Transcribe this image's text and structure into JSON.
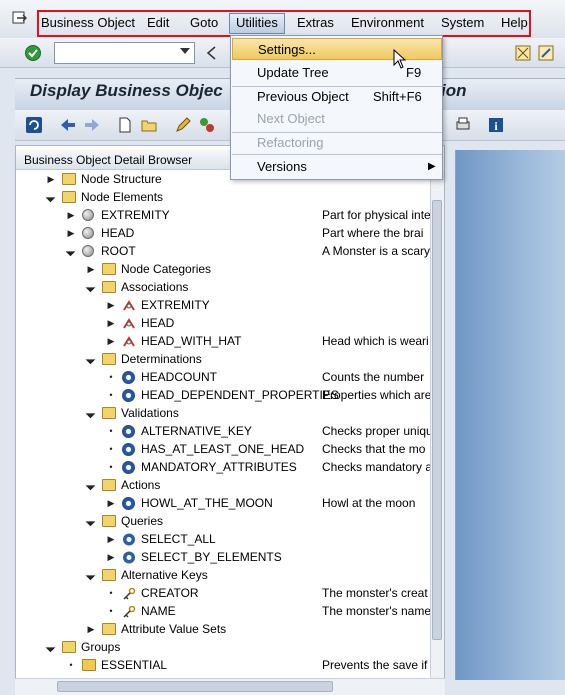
{
  "menubar": {
    "items": [
      "Business Object",
      "Edit",
      "Goto",
      "Utilities",
      "Extras",
      "Environment",
      "System",
      "Help"
    ]
  },
  "title": {
    "left": "Display Business Objec",
    "right": "ion"
  },
  "panel": {
    "header": "Business Object Detail Browser"
  },
  "tree": [
    {
      "label": "Node Structure",
      "desc": ""
    },
    {
      "label": "Node Elements",
      "desc": ""
    },
    {
      "label": "EXTREMITY",
      "desc": "Part for physical inte"
    },
    {
      "label": "HEAD",
      "desc": "Part where the brai"
    },
    {
      "label": "ROOT",
      "desc": "A Monster is a scary"
    },
    {
      "label": "Node Categories",
      "desc": ""
    },
    {
      "label": "Associations",
      "desc": ""
    },
    {
      "label": "EXTREMITY",
      "desc": ""
    },
    {
      "label": "HEAD",
      "desc": ""
    },
    {
      "label": "HEAD_WITH_HAT",
      "desc": "Head which is weari"
    },
    {
      "label": "Determinations",
      "desc": ""
    },
    {
      "label": "HEADCOUNT",
      "desc": "Counts the number"
    },
    {
      "label": "HEAD_DEPENDENT_PROPERTIES",
      "desc": "Properties which are"
    },
    {
      "label": "Validations",
      "desc": ""
    },
    {
      "label": "ALTERNATIVE_KEY",
      "desc": "Checks proper uniqu"
    },
    {
      "label": "HAS_AT_LEAST_ONE_HEAD",
      "desc": "Checks that the mo"
    },
    {
      "label": "MANDATORY_ATTRIBUTES",
      "desc": "Checks mandatory a"
    },
    {
      "label": "Actions",
      "desc": ""
    },
    {
      "label": "HOWL_AT_THE_MOON",
      "desc": "Howl at the moon"
    },
    {
      "label": "Queries",
      "desc": ""
    },
    {
      "label": "SELECT_ALL",
      "desc": ""
    },
    {
      "label": "SELECT_BY_ELEMENTS",
      "desc": ""
    },
    {
      "label": "Alternative Keys",
      "desc": ""
    },
    {
      "label": "CREATOR",
      "desc": "The monster's creat"
    },
    {
      "label": "NAME",
      "desc": "The monster's name"
    },
    {
      "label": "Attribute Value Sets",
      "desc": ""
    },
    {
      "label": "Groups",
      "desc": ""
    },
    {
      "label": "ESSENTIAL",
      "desc": "Prevents the save if"
    }
  ],
  "utilities_menu": {
    "items": [
      {
        "label": "Settings...",
        "shortcut": ""
      },
      {
        "label": "Update Tree",
        "shortcut": "F9"
      },
      {
        "label": "Previous Object",
        "shortcut": "Shift+F6"
      },
      {
        "label": "Next Object",
        "shortcut": ""
      },
      {
        "label": "Refactoring",
        "shortcut": ""
      },
      {
        "label": "Versions",
        "shortcut": ""
      }
    ]
  }
}
